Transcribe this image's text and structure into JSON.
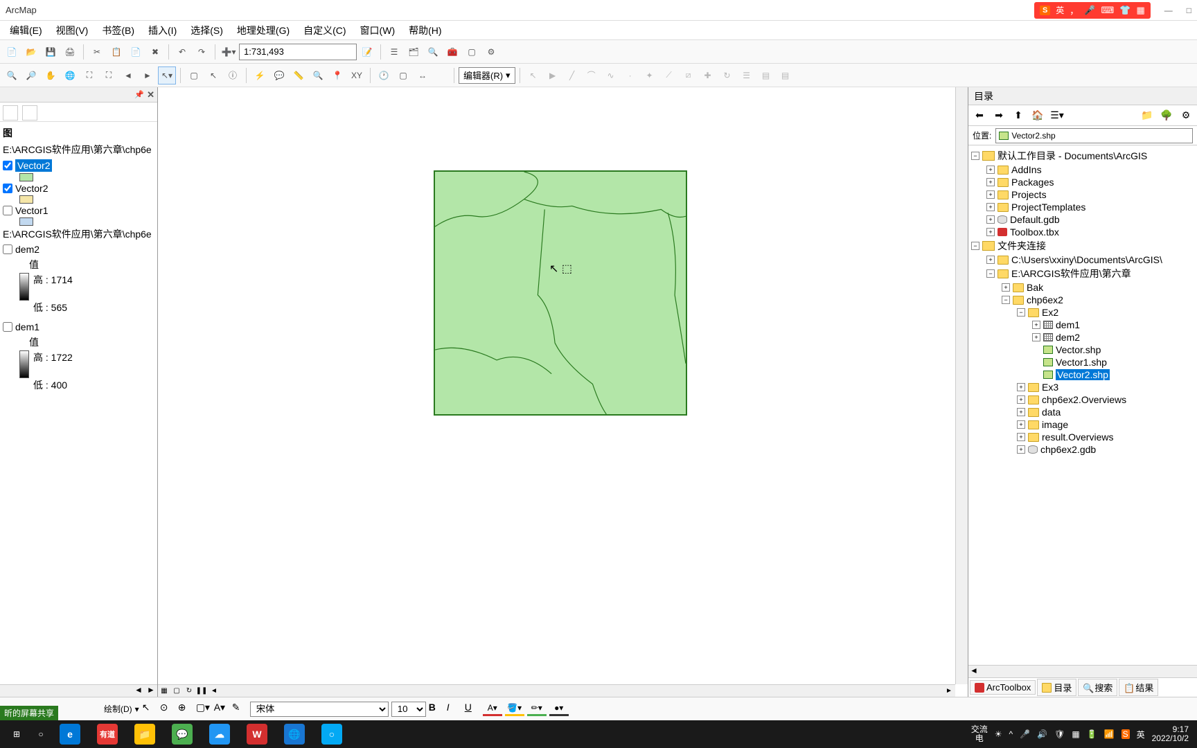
{
  "app": {
    "title": "ArcMap"
  },
  "ime": {
    "lang": "英",
    "badge": "S"
  },
  "menu": [
    "编辑(E)",
    "视图(V)",
    "书签(B)",
    "插入(I)",
    "选择(S)",
    "地理处理(G)",
    "自定义(C)",
    "窗口(W)",
    "帮助(H)"
  ],
  "toolbar1": {
    "scale": "1:731,493"
  },
  "toolbar2": {
    "editor_label": "编辑器(R)"
  },
  "toc": {
    "group1_path": "E:\\ARCGIS软件应用\\第六章\\chp6e",
    "layer_v2a": "Vector2",
    "layer_v2b": "Vector2",
    "layer_v1": "Vector1",
    "group2_path": "E:\\ARCGIS软件应用\\第六章\\chp6e",
    "dem2": {
      "name": "dem2",
      "value_label": "值",
      "high": "高 : 1714",
      "low": "低 : 565"
    },
    "dem1": {
      "name": "dem1",
      "value_label": "值",
      "high": "高 : 1722",
      "low": "低 : 400"
    },
    "swatch_colors": {
      "v2a": "#b3e6a8",
      "v2b": "#f5e6a8",
      "v1": "#c2d9f0"
    },
    "tab": "图"
  },
  "catalog": {
    "title": "目录",
    "loc_label": "位置:",
    "loc_value": "Vector2.shp",
    "root1": "默认工作目录 - Documents\\ArcGIS",
    "root1_children": [
      "AddIns",
      "Packages",
      "Projects",
      "ProjectTemplates",
      "Default.gdb",
      "Toolbox.tbx"
    ],
    "root2": "文件夹连接",
    "conn1": "C:\\Users\\xxiny\\Documents\\ArcGIS\\",
    "conn2": "E:\\ARCGIS软件应用\\第六章",
    "conn2_children": {
      "bak": "Bak",
      "chp6ex2": "chp6ex2",
      "ex2": "Ex2",
      "ex2_children": [
        "dem1",
        "dem2",
        "Vector.shp",
        "Vector1.shp",
        "Vector2.shp"
      ],
      "ex3": "Ex3",
      "overviews": "chp6ex2.Overviews",
      "data": "data",
      "image": "image",
      "result_ov": "result.Overviews",
      "gdb": "chp6ex2.gdb"
    },
    "tabs": [
      "ArcToolbox",
      "目录",
      "搜索",
      "结果"
    ]
  },
  "draw": {
    "label": "绘制(D)",
    "font": "宋体",
    "size": "10"
  },
  "taskbar": {
    "ime_status1": "交流",
    "ime_status2": "电",
    "tray_lang": "英",
    "time": "9:17",
    "date": "2022/10/2",
    "share": "昕的屏幕共享"
  }
}
